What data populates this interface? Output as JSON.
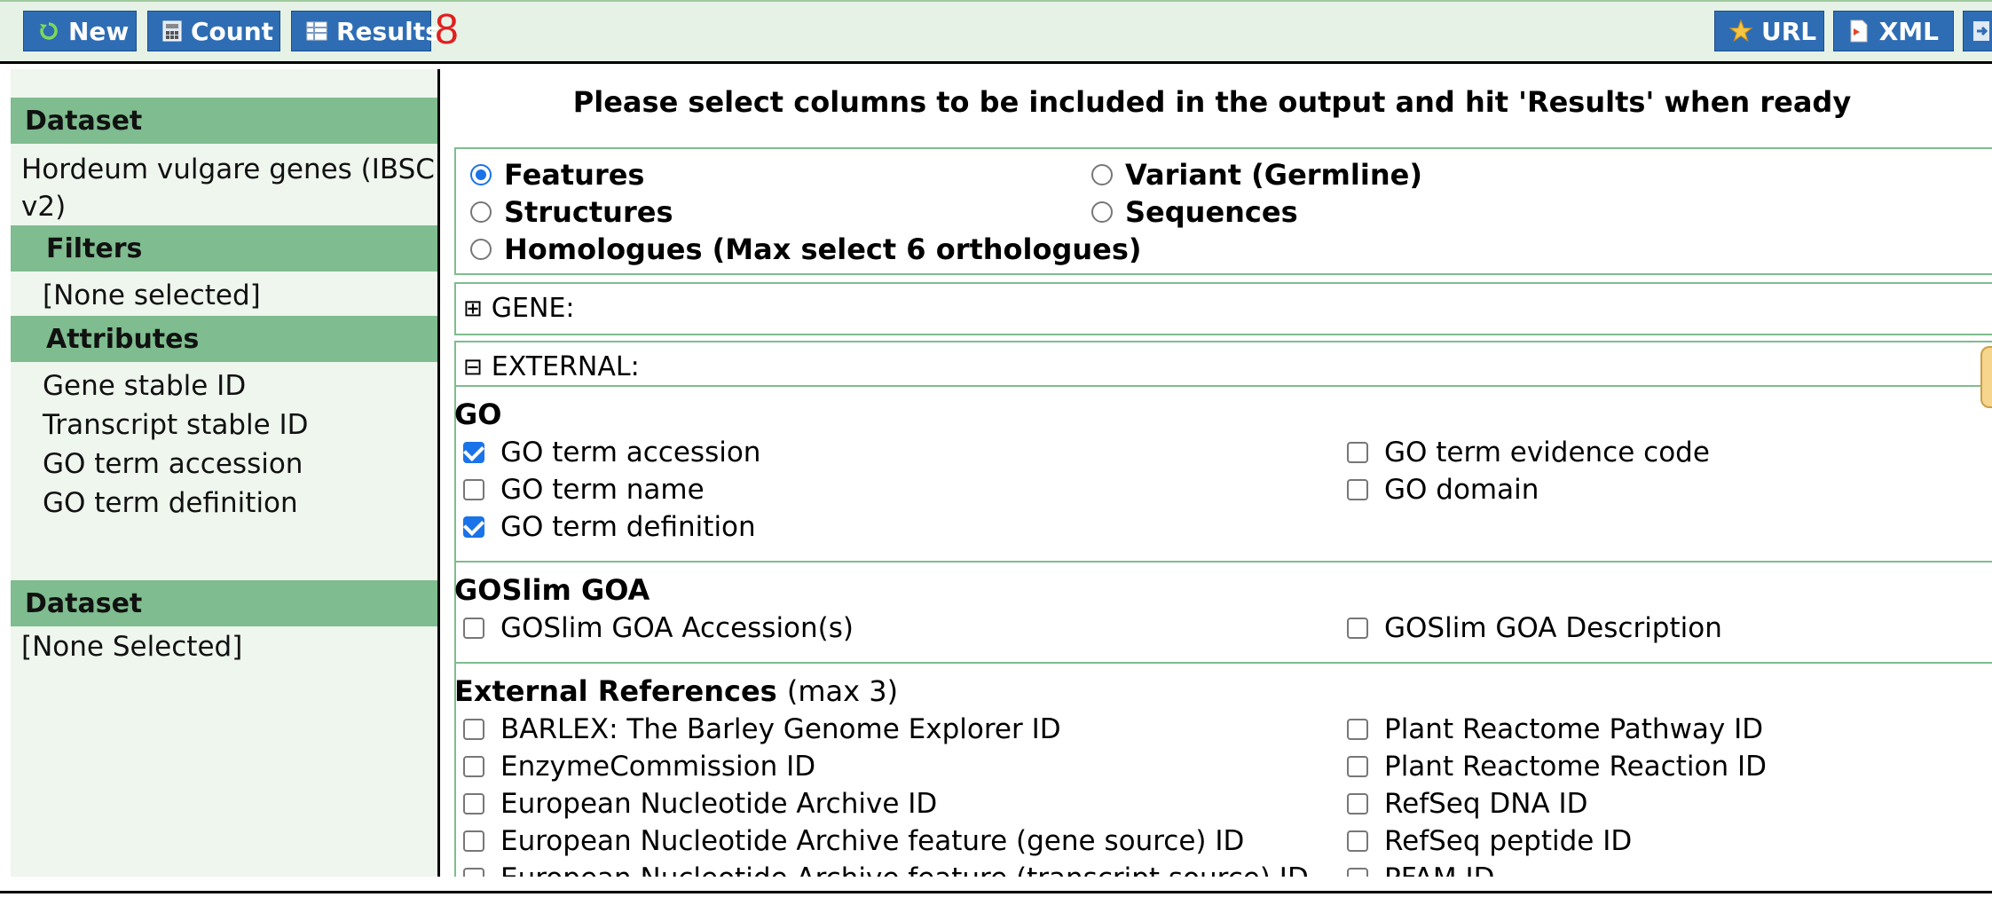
{
  "toolbar": {
    "new_label": "New",
    "count_label": "Count",
    "results_label": "Results",
    "results_count": "8",
    "url_label": "URL",
    "xml_label": "XML",
    "accent": "#2e6db4"
  },
  "sidebar": {
    "dataset_heading": "Dataset",
    "dataset_name": "Hordeum vulgare genes (IBSC v2)",
    "filters_heading": "Filters",
    "filters_value": "[None selected]",
    "attributes_heading": "Attributes",
    "attributes": [
      "Gene stable ID",
      "Transcript stable ID",
      "GO term accession",
      "GO term definition"
    ],
    "dataset2_heading": "Dataset",
    "dataset2_value": "[None Selected]"
  },
  "main": {
    "title": "Please select columns to be included in the output and hit 'Results' when ready",
    "attribute_pages": [
      {
        "label": "Features",
        "selected": true
      },
      {
        "label": "Variant (Germline)",
        "selected": false
      },
      {
        "label": "Structures",
        "selected": false
      },
      {
        "label": "Sequences",
        "selected": false
      },
      {
        "label": "Homologues (Max select 6 orthologues)",
        "selected": false
      }
    ],
    "gene_section": {
      "toggle": "⊞",
      "label": "GENE:"
    },
    "external_section": {
      "toggle": "⊟",
      "label": "EXTERNAL:"
    },
    "go": {
      "title": "GO",
      "options": [
        {
          "label": "GO term accession",
          "checked": true
        },
        {
          "label": "GO term evidence code",
          "checked": false
        },
        {
          "label": "GO term name",
          "checked": false
        },
        {
          "label": "GO domain",
          "checked": false
        },
        {
          "label": "GO term definition",
          "checked": true
        }
      ]
    },
    "goslim": {
      "title": "GOSlim GOA",
      "options": [
        {
          "label": "GOSlim GOA Accession(s)",
          "checked": false
        },
        {
          "label": "GOSlim GOA Description",
          "checked": false
        }
      ]
    },
    "xrefs": {
      "title": "External References",
      "subtitle": "(max 3)",
      "options": [
        {
          "label": "BARLEX: The Barley Genome Explorer ID",
          "checked": false
        },
        {
          "label": "Plant Reactome Pathway ID",
          "checked": false
        },
        {
          "label": "EnzymeCommission ID",
          "checked": false
        },
        {
          "label": "Plant Reactome Reaction ID",
          "checked": false
        },
        {
          "label": "European Nucleotide Archive ID",
          "checked": false
        },
        {
          "label": "RefSeq DNA ID",
          "checked": false
        },
        {
          "label": "European Nucleotide Archive feature (gene source) ID",
          "checked": false
        },
        {
          "label": "RefSeq peptide ID",
          "checked": false
        },
        {
          "label": "European Nucleotide Archive feature (transcript source) ID",
          "checked": false
        },
        {
          "label": "PFAM ID",
          "checked": false
        }
      ]
    }
  }
}
